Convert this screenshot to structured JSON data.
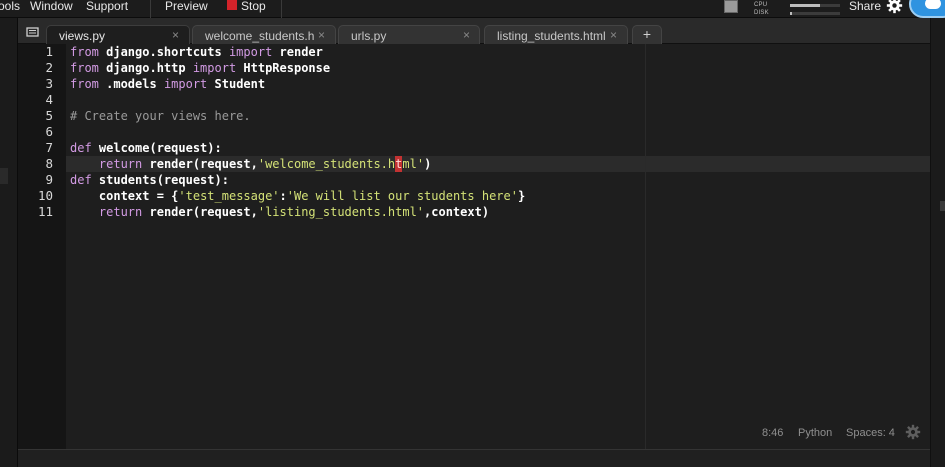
{
  "menubar": {
    "items": [
      "ools",
      "Window",
      "Support",
      "Preview",
      "Stop"
    ],
    "cpu_label": "CPU",
    "disk_label": "DISK",
    "cpu_level": 0.6,
    "disk_level": 0.04,
    "share_label": "Share",
    "stop_color": "#d3232a"
  },
  "tabs": [
    {
      "label": "views.py",
      "active": true
    },
    {
      "label": "welcome_students.h",
      "active": false
    },
    {
      "label": "urls.py",
      "active": false
    },
    {
      "label": "listing_students.html",
      "active": false
    }
  ],
  "tab_close_glyph": "×",
  "new_tab_glyph": "+",
  "editor": {
    "line_numbers": [
      "1",
      "2",
      "3",
      "4",
      "5",
      "6",
      "7",
      "8",
      "9",
      "10",
      "11"
    ],
    "current_line": 8,
    "code": {
      "l1": {
        "kw1": "from",
        "mod": " django.shortcuts ",
        "kw2": "import",
        "name": " render"
      },
      "l2": {
        "kw1": "from",
        "mod": " django.http ",
        "kw2": "import",
        "name": " HttpResponse"
      },
      "l3": {
        "kw1": "from",
        "mod": " .models ",
        "kw2": "import",
        "name": " Student"
      },
      "l5": {
        "comment": "# Create your views here."
      },
      "l7": {
        "kw": "def",
        "rest": " welcome(request):"
      },
      "l8": {
        "indent": "    ",
        "kw": "return",
        "call": " render(request,",
        "str_a": "'welcome_students.h",
        "cursor_char": "t",
        "str_b": "ml'",
        "close": ")"
      },
      "l9": {
        "kw": "def",
        "rest": " students(request):"
      },
      "l10": {
        "indent": "    ",
        "var": "context = {",
        "key": "'test_message'",
        "colon": ":",
        "val": "'We will list our students here'",
        "close": "}"
      },
      "l11": {
        "indent": "    ",
        "kw": "return",
        "call": " render(request,",
        "str": "'listing_students.html'",
        "close": ",context)"
      }
    }
  },
  "status": {
    "position": "8:46",
    "language": "Python",
    "indent": "Spaces: 4"
  },
  "colors": {
    "keyword": "#d39be4",
    "string": "#d4e277",
    "comment": "#9a9a9a",
    "cursor": "#c23232"
  }
}
